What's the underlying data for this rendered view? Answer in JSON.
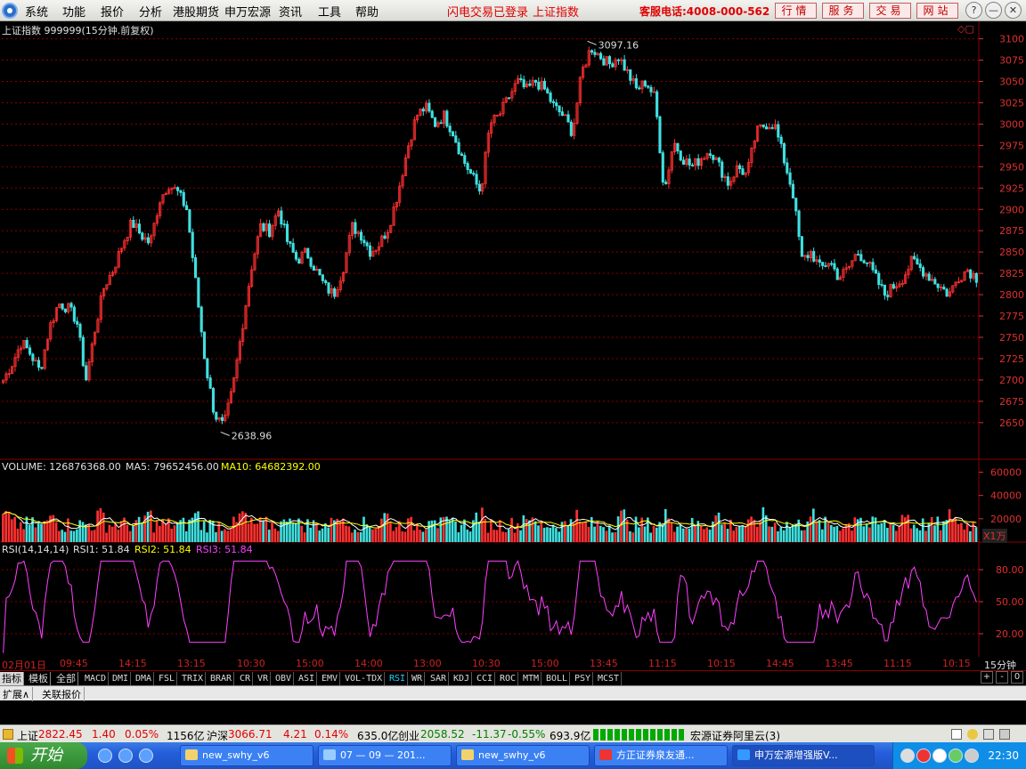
{
  "menu": [
    "系统",
    "功能",
    "报价",
    "分析",
    "港股期货",
    "申万宏源",
    "资讯",
    "工具",
    "帮助"
  ],
  "alerts": [
    "闪电交易已登录",
    "上证指数"
  ],
  "hotline": "客服电话:4008-000-562",
  "quick_buttons": [
    "行情",
    "服务",
    "交易",
    "网站"
  ],
  "window_controls": [
    "?",
    "—",
    "▭",
    "✕"
  ],
  "main_title": "上证指数 999999(15分钟.前复权)",
  "main_hi_label": "3097.16",
  "main_lo_label": "2638.96",
  "volume_header": {
    "prefix": "VOLUME: 126876368.00",
    "ma5": "MA5: 79652456.00",
    "ma10": "MA10: 64682392.00"
  },
  "volume_unit": "X1万",
  "rsi_header": {
    "name": "RSI(14,14,14)",
    "rsi1": "RSI1: 51.84",
    "rsi2": "RSI2: 51.84",
    "rsi3": "RSI3: 51.84"
  },
  "time_axis": [
    "02月01日",
    "09:45",
    "14:15",
    "13:15",
    "10:30",
    "15:00",
    "14:00",
    "13:00",
    "10:30",
    "15:00",
    "13:45",
    "11:15",
    "10:15",
    "14:45",
    "13:45",
    "11:15",
    "10:15"
  ],
  "period_label": "15分钟",
  "indicator_categories": [
    "指标",
    "模板",
    "全部"
  ],
  "indicators": [
    "MACD",
    "DMI",
    "DMA",
    "FSL",
    "TRIX",
    "BRAR",
    "CR",
    "VR",
    "OBV",
    "ASI",
    "EMV",
    "VOL-TDX",
    "RSI",
    "WR",
    "SAR",
    "KDJ",
    "CCI",
    "ROC",
    "MTM",
    "BOLL",
    "PSY",
    "MCST"
  ],
  "active_indicator": "RSI",
  "panel_controls": [
    "+",
    "-",
    "0"
  ],
  "sub_tabs": [
    "扩展∧",
    "关联报价"
  ],
  "status": {
    "sh_label": "上证",
    "sh_value": "2822.45",
    "sh_change": "1.40",
    "sh_pct": "0.05%",
    "sh_amt": "1156亿",
    "hs_label": "沪深",
    "hs_value": "3066.71",
    "hs_change": "4.21",
    "hs_pct": "0.14%",
    "hs_amt": "635.0亿",
    "cy_label": "创业",
    "cy_value": "2058.52",
    "cy_change": "-11.37",
    "cy_pct": "-0.55%",
    "cy_amt": "693.9亿",
    "broker": "宏源证券阿里云(3)"
  },
  "taskbar": {
    "start": "开始",
    "tasks": [
      "new_swhy_v6",
      "07 — 09 — 201...",
      "new_swhy_v6",
      "方正证券泉友通...",
      "申万宏源增强版V..."
    ],
    "clock": "22:30"
  },
  "colors": {
    "up": "#ff3030",
    "down": "#40e0e0",
    "ma5": "#ffffff",
    "ma10": "#ffff00",
    "rsi": "#ff40ff",
    "grid": "#8a0000",
    "axis_text": "#e03030"
  },
  "chart_data": {
    "type": "candlestick",
    "price_axis": {
      "ticks": [
        2650,
        2675,
        2700,
        2725,
        2750,
        2775,
        2800,
        2825,
        2850,
        2875,
        2900,
        2925,
        2950,
        2975,
        3000,
        3025,
        3050,
        3075,
        3100
      ],
      "range": [
        2630,
        3110
      ]
    },
    "volume_axis": {
      "ticks": [
        20000,
        40000,
        60000
      ],
      "unit": "X1万",
      "range": [
        0,
        65000
      ]
    },
    "rsi_axis": {
      "ticks": [
        20.0,
        50.0,
        80.0
      ],
      "range": [
        0,
        100
      ]
    },
    "high": 3097.16,
    "low": 2638.96,
    "close_path": [
      2700,
      2720,
      2745,
      2730,
      2710,
      2760,
      2790,
      2785,
      2770,
      2700,
      2760,
      2810,
      2830,
      2860,
      2885,
      2870,
      2860,
      2910,
      2930,
      2920,
      2900,
      2810,
      2720,
      2660,
      2645,
      2690,
      2760,
      2830,
      2880,
      2875,
      2900,
      2860,
      2840,
      2850,
      2830,
      2810,
      2800,
      2830,
      2880,
      2870,
      2850,
      2860,
      2880,
      2920,
      2970,
      3010,
      3020,
      3000,
      3010,
      2990,
      2960,
      2940,
      2920,
      3000,
      3010,
      3030,
      3050,
      3040,
      3050,
      3040,
      3020,
      3010,
      2990,
      3060,
      3090,
      3080,
      3070,
      3080,
      3060,
      3040,
      3050,
      3030,
      2920,
      2980,
      2960,
      2950,
      2960,
      2970,
      2950,
      2930,
      2950,
      2940,
      2990,
      3000,
      3000,
      2960,
      2920,
      2840,
      2850,
      2830,
      2840,
      2820,
      2830,
      2850,
      2840,
      2820,
      2800,
      2810,
      2820,
      2840,
      2830,
      2820,
      2810,
      2800,
      2820,
      2830,
      2820
    ]
  }
}
